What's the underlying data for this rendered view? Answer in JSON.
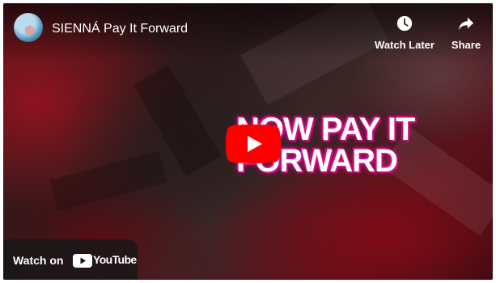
{
  "video": {
    "title": "SIENNÁ Pay It Forward",
    "headline_line1": "NOW PAY IT",
    "headline_line2": "FORWARD"
  },
  "actions": {
    "watch_later_label": "Watch Later",
    "share_label": "Share"
  },
  "watch_on": {
    "label": "Watch on",
    "brand": "YouTube"
  },
  "icons": [
    "clock-icon",
    "share-arrow-icon",
    "play-button-icon",
    "youtube-logo-icon"
  ],
  "colors": {
    "play_red": "#ff0000",
    "headline_glow": "#c01080",
    "overlay_dark": "#171717"
  }
}
